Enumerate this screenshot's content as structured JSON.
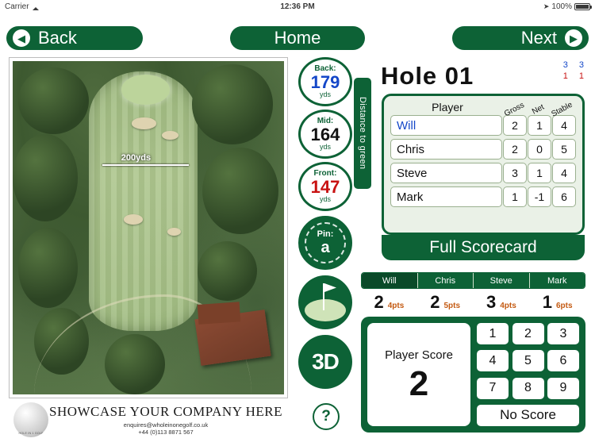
{
  "statusbar": {
    "carrier": "Carrier",
    "wifi_icon": "wifi-icon",
    "time": "12:36 PM",
    "location_icon": "location-arrow-icon",
    "battery_pct": "100%"
  },
  "navbar": {
    "back_label": "Back",
    "home_label": "Home",
    "next_label": "Next",
    "back_icon": "chevron-left-icon",
    "next_icon": "chevron-right-icon"
  },
  "map": {
    "yardage_marker": "200yds"
  },
  "advert": {
    "title": "SHOWCASE YOUR COMPANY HERE",
    "email": "enquires@wholeinonegolf.co.uk",
    "phone": "+44 (0)113 8871 567",
    "ball_text": "HOLE IN 1 GOLF"
  },
  "distances": {
    "side_label": "Distance to green",
    "items": [
      {
        "label": "Back:",
        "value": "179",
        "units": "yds",
        "color": "#1447c8"
      },
      {
        "label": "Mid:",
        "value": "164",
        "units": "yds",
        "color": "#111111"
      },
      {
        "label": "Front:",
        "value": "147",
        "units": "yds",
        "color": "#c81212"
      }
    ],
    "pin": {
      "label": "Pin:",
      "value": "a"
    },
    "flag_icon": "green-flag-icon",
    "threed_label": "3D",
    "help_label": "?"
  },
  "hole": {
    "title": "Hole 01",
    "meta": [
      {
        "top": "3",
        "bottom": "1"
      },
      {
        "top": "3",
        "bottom": "1"
      }
    ]
  },
  "scorecard": {
    "headers": {
      "player": "Player",
      "gross": "Gross",
      "net": "Net",
      "stable": "Stable"
    },
    "rows": [
      {
        "name": "Will",
        "gross": "2",
        "net": "1",
        "stable": "4",
        "active": true
      },
      {
        "name": "Chris",
        "gross": "2",
        "net": "0",
        "stable": "5",
        "active": false
      },
      {
        "name": "Steve",
        "gross": "3",
        "net": "1",
        "stable": "4",
        "active": false
      },
      {
        "name": "Mark",
        "gross": "1",
        "net": "-1",
        "stable": "6",
        "active": false
      }
    ],
    "full_scorecard_label": "Full Scorecard"
  },
  "player_tabs": [
    {
      "label": "Will",
      "active": true
    },
    {
      "label": "Chris",
      "active": false
    },
    {
      "label": "Steve",
      "active": false
    },
    {
      "label": "Mark",
      "active": false
    }
  ],
  "score_strip": [
    {
      "score": "2",
      "points": "4pts"
    },
    {
      "score": "2",
      "points": "5pts"
    },
    {
      "score": "3",
      "points": "4pts"
    },
    {
      "score": "1",
      "points": "6pts"
    }
  ],
  "keypad": {
    "player_score_label": "Player Score",
    "player_score_value": "2",
    "keys": [
      "1",
      "2",
      "3",
      "4",
      "5",
      "6",
      "7",
      "8",
      "9"
    ],
    "no_score_label": "No Score"
  },
  "colors": {
    "brand_green": "#0d6236",
    "blue": "#1447c8",
    "red": "#c81212",
    "points_orange": "#c45a12"
  }
}
